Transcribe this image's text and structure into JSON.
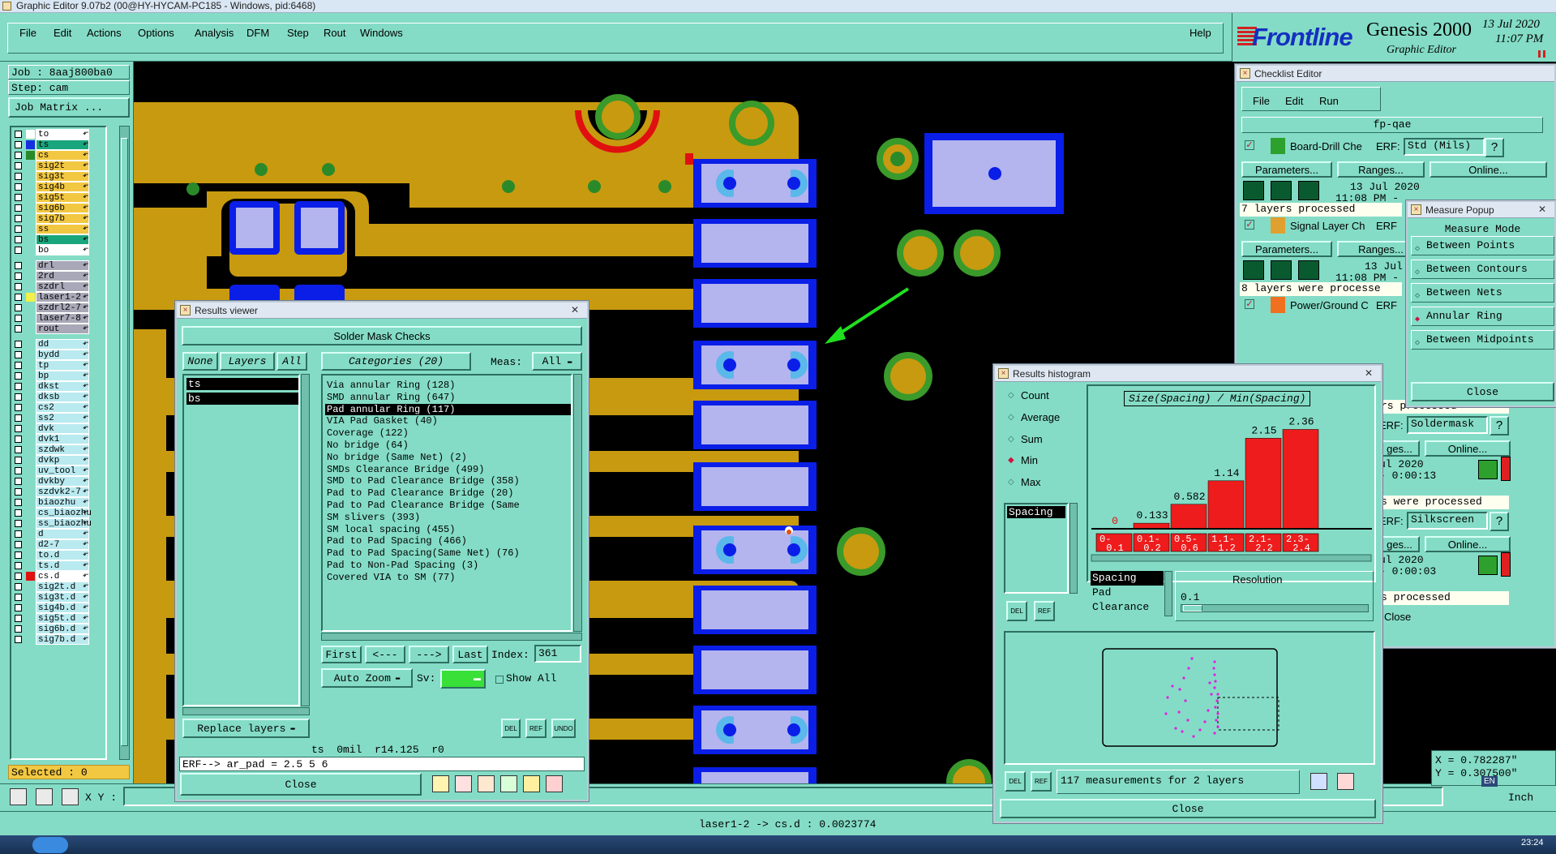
{
  "window_title": "Graphic Editor 9.07b2 (00@HY-HYCAM-PC185 - Windows, pid:6468)",
  "menu": {
    "file": "File",
    "edit": "Edit",
    "actions": "Actions",
    "options": "Options",
    "analysis": "Analysis",
    "dfm": "DFM",
    "step": "Step",
    "rout": "Rout",
    "windows": "Windows",
    "help": "Help"
  },
  "brand": {
    "logo": "Frontline",
    "product": "Genesis 2000",
    "subtitle": "Graphic Editor",
    "date": "13 Jul 2020",
    "time": "11:07 PM"
  },
  "job": {
    "job_label": "Job : 8aaj800ba0",
    "step_label": "Step: cam",
    "matrix_button": "Job Matrix ..."
  },
  "layers": [
    {
      "name": "to",
      "color": "#ffffff",
      "sel": "#ffffff"
    },
    {
      "name": "ts",
      "color": "#1530e0",
      "sel": "#1aa67d"
    },
    {
      "name": "cs",
      "color": "#2a8a2a",
      "sel": "#f2c842"
    },
    {
      "name": "sig2t",
      "color": "",
      "sel": "#f2c842"
    },
    {
      "name": "sig3t",
      "color": "",
      "sel": "#f2c842"
    },
    {
      "name": "sig4b",
      "color": "",
      "sel": "#f2c842"
    },
    {
      "name": "sig5t",
      "color": "",
      "sel": "#f2c842"
    },
    {
      "name": "sig6b",
      "color": "",
      "sel": "#f2c842"
    },
    {
      "name": "sig7b",
      "color": "",
      "sel": "#f2c842"
    },
    {
      "name": "ss",
      "color": "",
      "sel": "#f2c842"
    },
    {
      "name": "bs",
      "color": "",
      "sel": "#1aa67d"
    },
    {
      "name": "bo",
      "color": "",
      "sel": "#ffffff"
    },
    {
      "name": "drl",
      "color": "",
      "sel": "#a8a8b8"
    },
    {
      "name": "2rd",
      "color": "",
      "sel": "#a8a8b8"
    },
    {
      "name": "szdrl",
      "color": "",
      "sel": "#a8a8b8"
    },
    {
      "name": "laser1-2",
      "color": "#f4f04a",
      "sel": "#a8a8b8"
    },
    {
      "name": "szdrl2-7",
      "color": "",
      "sel": "#a8a8b8"
    },
    {
      "name": "laser7-8",
      "color": "",
      "sel": "#a8a8b8"
    },
    {
      "name": "rout",
      "color": "",
      "sel": "#a8a8b8"
    },
    {
      "name": "dd",
      "color": "",
      "sel": "#b9eaf0"
    },
    {
      "name": "bydd",
      "color": "",
      "sel": "#b9eaf0"
    },
    {
      "name": "tp",
      "color": "",
      "sel": "#b9eaf0"
    },
    {
      "name": "bp",
      "color": "",
      "sel": "#b9eaf0"
    },
    {
      "name": "dkst",
      "color": "",
      "sel": "#b9eaf0"
    },
    {
      "name": "dksb",
      "color": "",
      "sel": "#b9eaf0"
    },
    {
      "name": "cs2",
      "color": "",
      "sel": "#b9eaf0"
    },
    {
      "name": "ss2",
      "color": "",
      "sel": "#b9eaf0"
    },
    {
      "name": "dvk",
      "color": "",
      "sel": "#b9eaf0"
    },
    {
      "name": "dvk1",
      "color": "",
      "sel": "#b9eaf0"
    },
    {
      "name": "szdwk",
      "color": "",
      "sel": "#b9eaf0"
    },
    {
      "name": "dvkp",
      "color": "",
      "sel": "#b9eaf0"
    },
    {
      "name": "uv_tool",
      "color": "",
      "sel": "#b9eaf0"
    },
    {
      "name": "dvkby",
      "color": "",
      "sel": "#b9eaf0"
    },
    {
      "name": "szdvk2-7",
      "color": "",
      "sel": "#b9eaf0"
    },
    {
      "name": "biaozhu",
      "color": "",
      "sel": "#b9eaf0"
    },
    {
      "name": "cs_biaozhu",
      "color": "",
      "sel": "#b9eaf0"
    },
    {
      "name": "ss_biaozhu",
      "color": "",
      "sel": "#b9eaf0"
    },
    {
      "name": "d",
      "color": "",
      "sel": "#b9eaf0"
    },
    {
      "name": "d2-7",
      "color": "",
      "sel": "#b9eaf0"
    },
    {
      "name": "to.d",
      "color": "",
      "sel": "#b9eaf0"
    },
    {
      "name": "ts.d",
      "color": "",
      "sel": "#b9eaf0"
    },
    {
      "name": "cs.d",
      "color": "#e01010",
      "sel": "#ffffff"
    },
    {
      "name": "sig2t.d",
      "color": "",
      "sel": "#b9eaf0"
    },
    {
      "name": "sig3t.d",
      "color": "",
      "sel": "#b9eaf0"
    },
    {
      "name": "sig4b.d",
      "color": "",
      "sel": "#b9eaf0"
    },
    {
      "name": "sig5t.d",
      "color": "",
      "sel": "#b9eaf0"
    },
    {
      "name": "sig6b.d",
      "color": "",
      "sel": "#b9eaf0"
    },
    {
      "name": "sig7b.d",
      "color": "",
      "sel": "#b9eaf0"
    }
  ],
  "selected_label": "Selected : 0",
  "xy_label": "X Y :",
  "status_bar": "laser1-2 -> cs.d : 0.0023774",
  "results_viewer": {
    "title": "Results viewer",
    "header": "Solder Mask Checks",
    "none_btn": "None",
    "layers_btn": "Layers",
    "all_btn": "All",
    "categories_btn": "Categories (20)",
    "meas_label": "Meas:",
    "meas_value": "All",
    "layer_list": [
      "ts",
      "bs"
    ],
    "categories": [
      "Via annular Ring (128)",
      "SMD annular Ring (647)",
      "Pad annular Ring (117)",
      "VIA Pad Gasket (40)",
      "Coverage (122)",
      "No bridge (64)",
      "No bridge (Same Net) (2)",
      "SMDs Clearance Bridge (499)",
      "SMD to Pad Clearance Bridge (358)",
      "Pad to Pad Clearance Bridge (20)",
      "Pad to Pad Clearance Bridge (Same",
      "SM slivers (393)",
      "SM local spacing (455)",
      "Pad to Pad Spacing (466)",
      "Pad to Pad Spacing(Same Net) (76)",
      "Pad to Non-Pad Spacing (3)",
      "Covered VIA to SM (77)"
    ],
    "selected_category": 2,
    "first": "First",
    "prev": "<---",
    "next": "--->",
    "last": "Last",
    "index_label": "Index:",
    "index_value": "361",
    "auto_zoom": "Auto Zoom",
    "sv_label": "Sv:",
    "show_all": "Show All",
    "replace_layers": "Replace layers",
    "info": "ts  0mil  r14.125  r0",
    "erf_line": "ERF--> ar_pad = 2.5 5 6",
    "close": "Close",
    "del": "DEL",
    "ref": "REF",
    "undo": "UNDO"
  },
  "checklist": {
    "title": "Checklist Editor",
    "menu_file": "File",
    "menu_edit": "Edit",
    "menu_run": "Run",
    "name": "fp-qae",
    "rows": [
      {
        "label": "Board-Drill Che",
        "erf": "ERF:",
        "erf_value": "Std (Mils)",
        "date": "13 Jul 2020",
        "time": "11:08 PM -",
        "status": "7 layers processed"
      },
      {
        "label": "Signal Layer Ch",
        "erf": "ERF",
        "erf_value": "",
        "date": "13 Jul",
        "time": "11:08 PM -",
        "status": "8 layers were processe"
      },
      {
        "label": "Power/Ground C",
        "erf": "ERF",
        "erf_value": "",
        "date": "",
        "time": "",
        "status": ""
      }
    ],
    "parameters": "Parameters...",
    "ranges": "Ranges...",
    "online": "Online...",
    "right_rows": [
      {
        "status": "rs processed",
        "erf": "ERF:",
        "erf_value": "Soldermask",
        "ranges": "ges...",
        "online": "Online...",
        "date": "ul 2020",
        "time": "- 0:00:13"
      },
      {
        "status": "s were processed",
        "erf": "ERF:",
        "erf_value": "Silkscreen",
        "ranges": "ges...",
        "online": "Online...",
        "date": "ul 2020",
        "time": "- 0:00:03"
      }
    ],
    "last_status": "s processed",
    "close": "Close"
  },
  "measure_popup": {
    "title": "Measure Popup",
    "mode": "Measure Mode",
    "options": [
      "Between Points",
      "Between Contours",
      "Between Nets",
      "Annular Ring",
      "Between Midpoints"
    ],
    "selected": 3,
    "close": "Close"
  },
  "histogram": {
    "title": "Results histogram",
    "stats": [
      "Count",
      "Average",
      "Sum",
      "Min",
      "Max"
    ],
    "selected_stat": 3,
    "measure_item": "Spacing",
    "chart_title": "Size(Spacing) / Min(Spacing)",
    "list_items": [
      "Spacing",
      "Pad",
      "Clearance"
    ],
    "resolution_label": "Resolution",
    "resolution_value": "0.1",
    "footer": "117 measurements for 2 layers",
    "close": "Close",
    "del": "DEL",
    "ref": "REF"
  },
  "chart_data": {
    "type": "bar",
    "title": "Size(Spacing) / Min(Spacing)",
    "categories": [
      "0-\n0.1",
      "0.1-\n0.2",
      "0.5-\n0.6",
      "1.1-\n1.2",
      "2.1-\n2.2",
      "2.3-\n2.4"
    ],
    "values": [
      0,
      0.133,
      0.582,
      1.14,
      2.15,
      2.36
    ],
    "labels": [
      "0",
      "0.133",
      "0.582",
      "1.14",
      "2.15",
      "2.36"
    ],
    "ylim": [
      0,
      2.6
    ]
  },
  "coords": {
    "x": "X = 0.782287\"",
    "y": "Y = 0.307500\"",
    "unit": "Inch"
  },
  "taskbar": {
    "lang": "EN",
    "clock": "23:24"
  },
  "colors": {
    "panel": "#84dcc6",
    "copper": "#c89a10",
    "pad": "#b4b4ee",
    "mask": "#0a1ee8",
    "hist_bar": "#ee1c1c"
  }
}
